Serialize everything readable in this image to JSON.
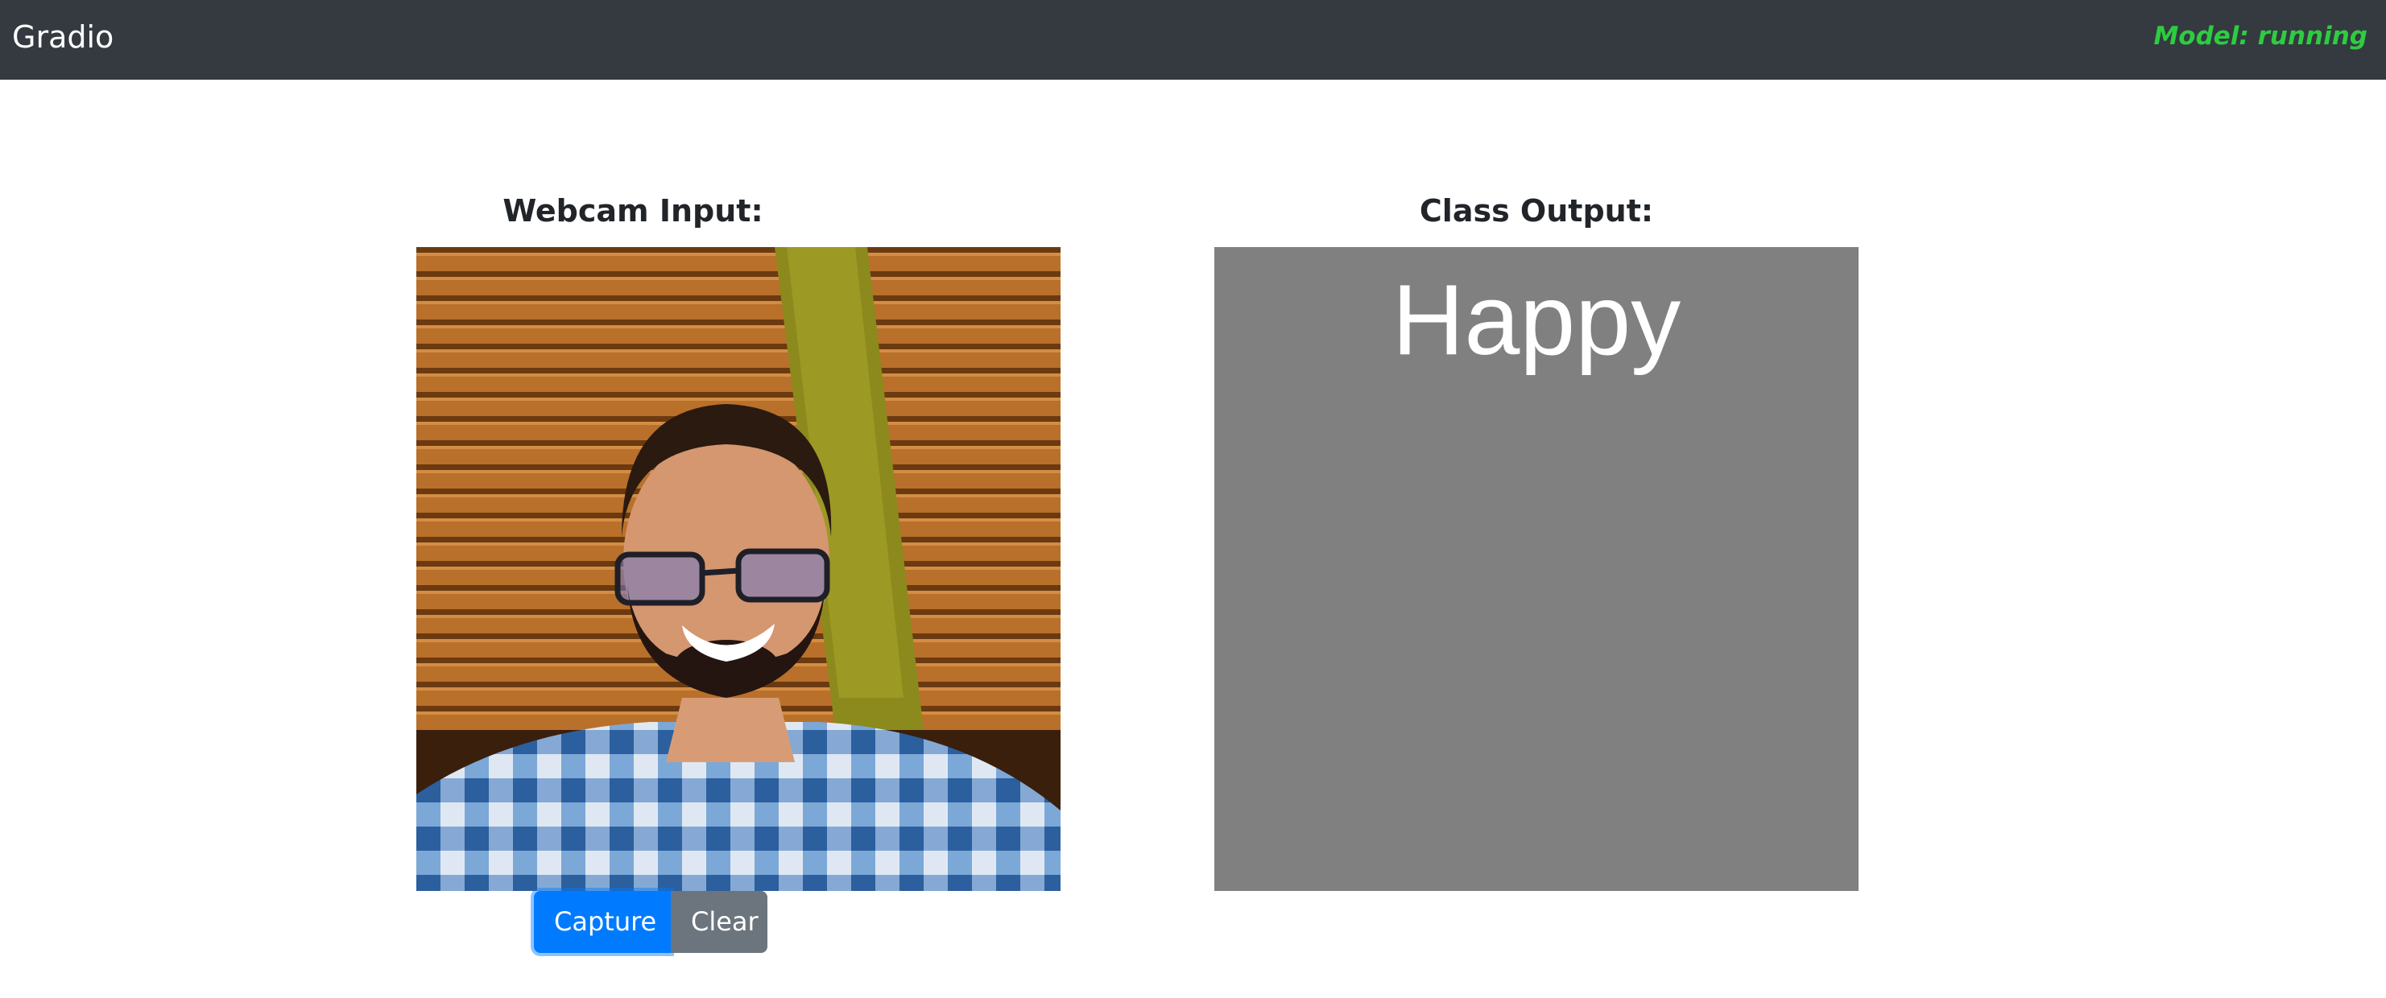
{
  "navbar": {
    "brand": "Gradio",
    "status": "Model: running",
    "status_color": "#2ecc40",
    "background": "#343a40"
  },
  "input": {
    "heading": "Webcam Input:",
    "buttons": {
      "capture": "Capture",
      "clear": "Clear"
    },
    "accent": "#007bff"
  },
  "output": {
    "heading": "Class Output:",
    "label": "Happy",
    "background": "#808080"
  }
}
